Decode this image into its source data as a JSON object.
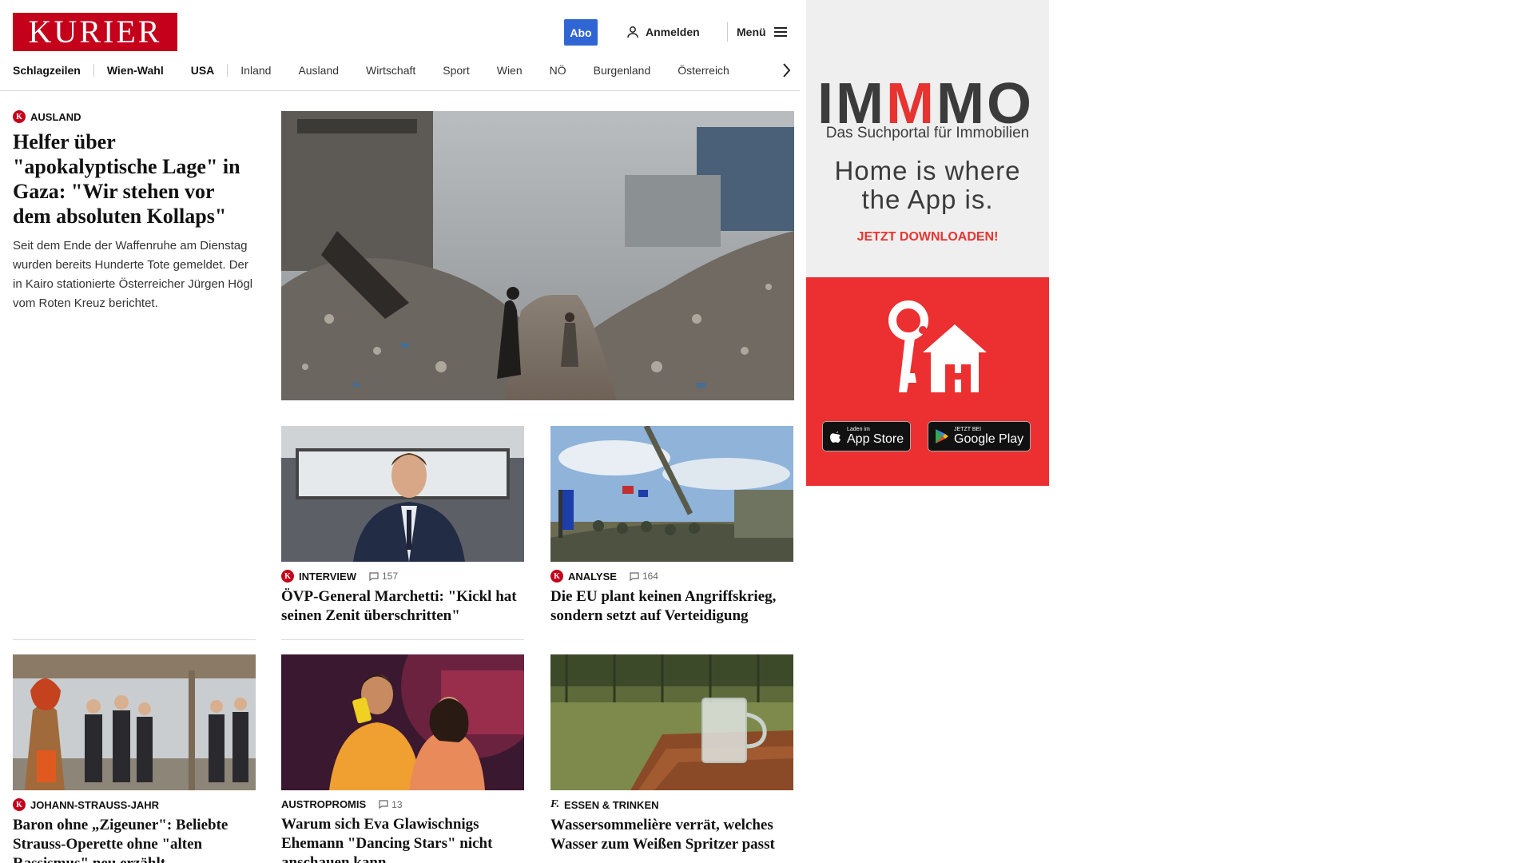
{
  "header": {
    "logo": "KURIER",
    "abo_label": "Abo",
    "login_label": "Anmelden",
    "menu_label": "Menü"
  },
  "nav": {
    "items": [
      "Schlagzeilen",
      "Wien-Wahl",
      "USA",
      "Inland",
      "Ausland",
      "Wirtschaft",
      "Sport",
      "Wien",
      "NÖ",
      "Burgenland",
      "Österreich"
    ]
  },
  "lead": {
    "kicker": "Ausland",
    "badge": "K",
    "headline": "Helfer über \"apokalyptische Lage\" in Gaza: \"Wir stehen vor dem absoluten Kollaps\"",
    "teaser": "Seit dem Ende der Waffenruhe am Dienstag wurden bereits Hunderte Tote gemeldet. Der in Kairo stationierte Österreicher Jürgen Högl vom Roten Kreuz berichtet."
  },
  "cards": [
    {
      "kicker": "Interview",
      "comments": "157",
      "headline": "ÖVP-General Marchetti: \"Kickl hat seinen Zenit überschritten\""
    },
    {
      "kicker": "Analyse",
      "comments": "164",
      "headline": "Die EU plant keinen Angriffskrieg, sondern setzt auf Verteidigung"
    },
    {
      "kicker": "Johann-Strauss-Jahr",
      "headline": "Baron ohne „Zigeuner\": Beliebte Strauss-Operette ohne \"alten Rassismus\" neu erzählt"
    },
    {
      "kicker": "Austropromis",
      "comments": "13",
      "headline": "Warum sich Eva Glawischnigs Ehemann \"Dancing Stars\" nicht anschauen kann"
    },
    {
      "kicker": "Essen & Trinken",
      "icon": "f.",
      "headline": "Wassersommelière verrät, welches Wasser zum Weißen Spritzer passt"
    }
  ],
  "ad": {
    "brand_left": "IM",
    "brand_mid": "M",
    "brand_right": "MO",
    "subtitle": "Das Suchportal für Immobilien",
    "slogan_line1": "Home is where",
    "slogan_line2": "the App is.",
    "cta": "JETZT DOWNLOADEN!",
    "appstore_small": "Laden im",
    "appstore_big": "App Store",
    "googleplay_small": "JETZT BEI",
    "googleplay_big": "Google Play",
    "brand_color": "#e73431"
  }
}
